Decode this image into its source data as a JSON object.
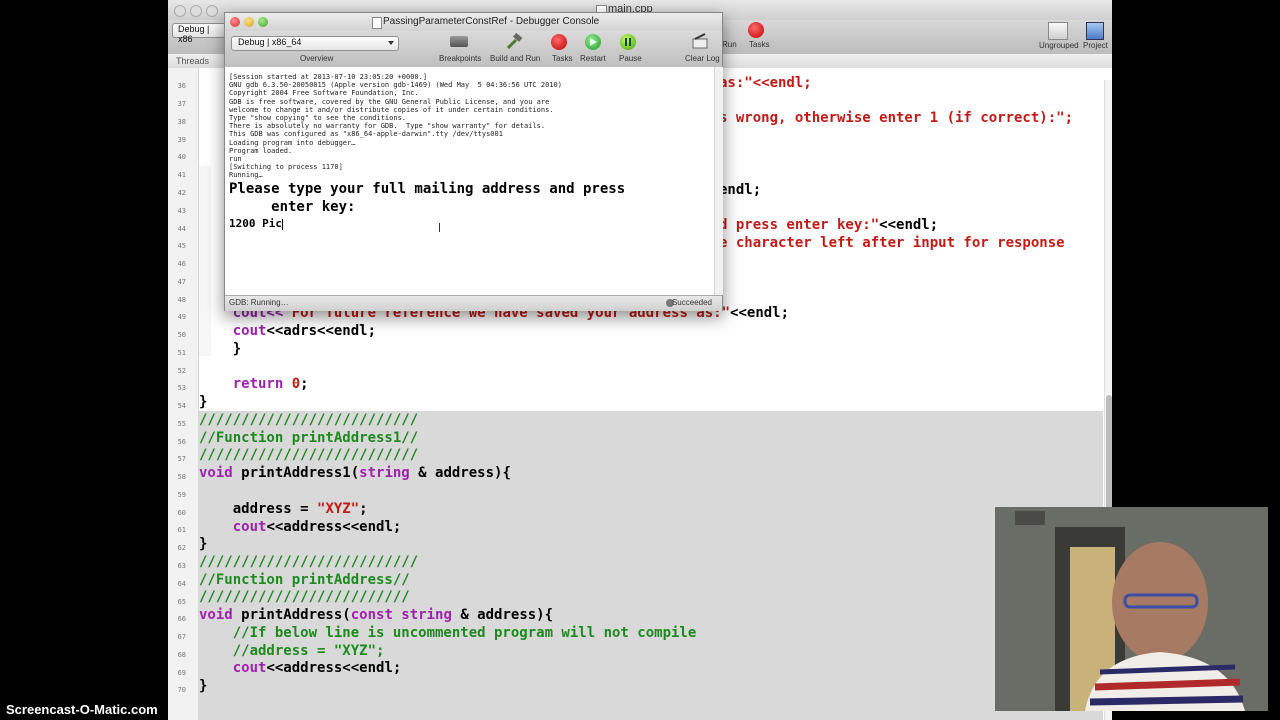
{
  "xcode": {
    "title": "main.cpp",
    "scheme": "Debug | x86",
    "toolbar": {
      "run_label": "Run",
      "tasks_label": "Tasks",
      "ungrouped_label": "Ungrouped",
      "project_label": "Project"
    },
    "threads_label": "Threads"
  },
  "console": {
    "title": "PassingParameterConstRef - Debugger Console",
    "scheme": "Debug | x86_64",
    "toolbar": {
      "overview": "Overview",
      "breakpoints": "Breakpoints",
      "build_and_run": "Build and Run",
      "tasks": "Tasks",
      "restart": "Restart",
      "pause": "Pause",
      "clear_log": "Clear Log"
    },
    "gdb_lines": [
      "[Session started at 2013-07-10 23:05:20 +0000.]",
      "GNU gdb 6.3.50-20050815 (Apple version gdb-1469) (Wed May  5 04:36:56 UTC 2010)",
      "Copyright 2004 Free Software Foundation, Inc.",
      "GDB is free software, covered by the GNU General Public License, and you are",
      "welcome to change it and/or distribute copies of it under certain conditions.",
      "Type \"show copying\" to see the conditions.",
      "There is absolutely no warranty for GDB.  Type \"show warranty\" for details.",
      "This GDB was configured as \"x86_64-apple-darwin\".tty /dev/ttys001",
      "Loading program into debugger…",
      "Program loaded.",
      "run",
      "[Switching to process 1170]",
      "Running…"
    ],
    "prompt_line1": "Please type your full mailing address and press",
    "prompt_line2": "     enter key:",
    "input_text": "1200 Pic",
    "status_left": "GDB: Running…",
    "status_right": "Succeeded"
  },
  "editor": {
    "line_numbers": [
      "36",
      "37",
      "38",
      "39",
      "40",
      "41",
      "42",
      "43",
      "44",
      "45",
      "46",
      "47",
      "48",
      "49",
      "50",
      "51",
      "52",
      "53",
      "54",
      "55",
      "56",
      "57",
      "58",
      "59",
      "60",
      "61",
      "62",
      "63",
      "64",
      "65",
      "66",
      "67",
      "68",
      "69",
      "70"
    ],
    "visible_frag_36": "as:\"<<endl;",
    "visible_frag_38": "s wrong, otherwise enter 1 (if correct):\";",
    "visible_frag_42": "endl;",
    "visible_frag_44_a": "d press enter key:\"",
    "visible_frag_44_b": "<<endl;",
    "visible_frag_45": "e character left after input for response",
    "line_48_a": "    cout<<",
    "line_48_b": "\"For future reference we have saved your address as:\"",
    "line_48_c": "<<endl;",
    "line_49_a": "    cout",
    "line_49_b": "<<adrs<<endl;",
    "line_50": "    }",
    "line_52_a": "    return ",
    "line_52_b": "0",
    "line_52_c": ";",
    "line_53": "}",
    "line_54": "//////////////////////////",
    "line_55": "//Function printAddress1//",
    "line_56": "//////////////////////////",
    "line_57_a": "void",
    "line_57_b": " printAddress1(",
    "line_57_c": "string",
    "line_57_d": " & address){",
    "line_59_a": "    address = ",
    "line_59_b": "\"XYZ\"",
    "line_59_c": ";",
    "line_60_a": "    cout",
    "line_60_b": "<<address<<endl;",
    "line_61": "}",
    "line_62": "//////////////////////////",
    "line_63": "//Function printAddress//",
    "line_64": "/////////////////////////",
    "line_65_a": "void",
    "line_65_b": " printAddress(",
    "line_65_c": "const string",
    "line_65_d": " & address){",
    "line_66": "    //If below line is uncommented program will not compile",
    "line_67": "    //address = \"XYZ\";",
    "line_68_a": "    cout",
    "line_68_b": "<<address<<endl;",
    "line_69": "}"
  },
  "watermark": "Screencast-O-Matic.com",
  "colors": {
    "keyword": "#a020b0",
    "string": "#c41a16",
    "comment": "#1c8a1c"
  }
}
